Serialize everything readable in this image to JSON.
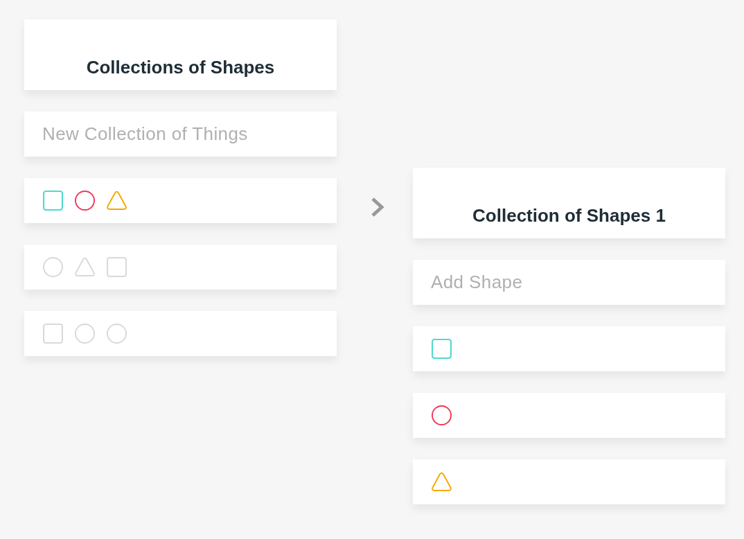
{
  "collections_panel": {
    "title": "Collections of Shapes",
    "input": {
      "placeholder": "New Collection of Things"
    },
    "collections": [
      {
        "shapes": [
          {
            "kind": "square",
            "color": "#4fd9cc"
          },
          {
            "kind": "circle",
            "color": "#f2385a"
          },
          {
            "kind": "triangle",
            "color": "#f7a800"
          }
        ]
      },
      {
        "shapes": [
          {
            "kind": "circle",
            "color": "#d9d9d9"
          },
          {
            "kind": "triangle",
            "color": "#d9d9d9"
          },
          {
            "kind": "square",
            "color": "#d9d9d9"
          }
        ]
      },
      {
        "shapes": [
          {
            "kind": "square",
            "color": "#d9d9d9"
          },
          {
            "kind": "circle",
            "color": "#d9d9d9"
          },
          {
            "kind": "circle",
            "color": "#d9d9d9"
          }
        ]
      }
    ]
  },
  "detail_panel": {
    "title": "Collection of Shapes 1",
    "input": {
      "placeholder": "Add Shape"
    },
    "shapes": [
      {
        "kind": "square",
        "color": "#4fd9cc"
      },
      {
        "kind": "circle",
        "color": "#f2385a"
      },
      {
        "kind": "triangle",
        "color": "#f7a800"
      }
    ]
  }
}
